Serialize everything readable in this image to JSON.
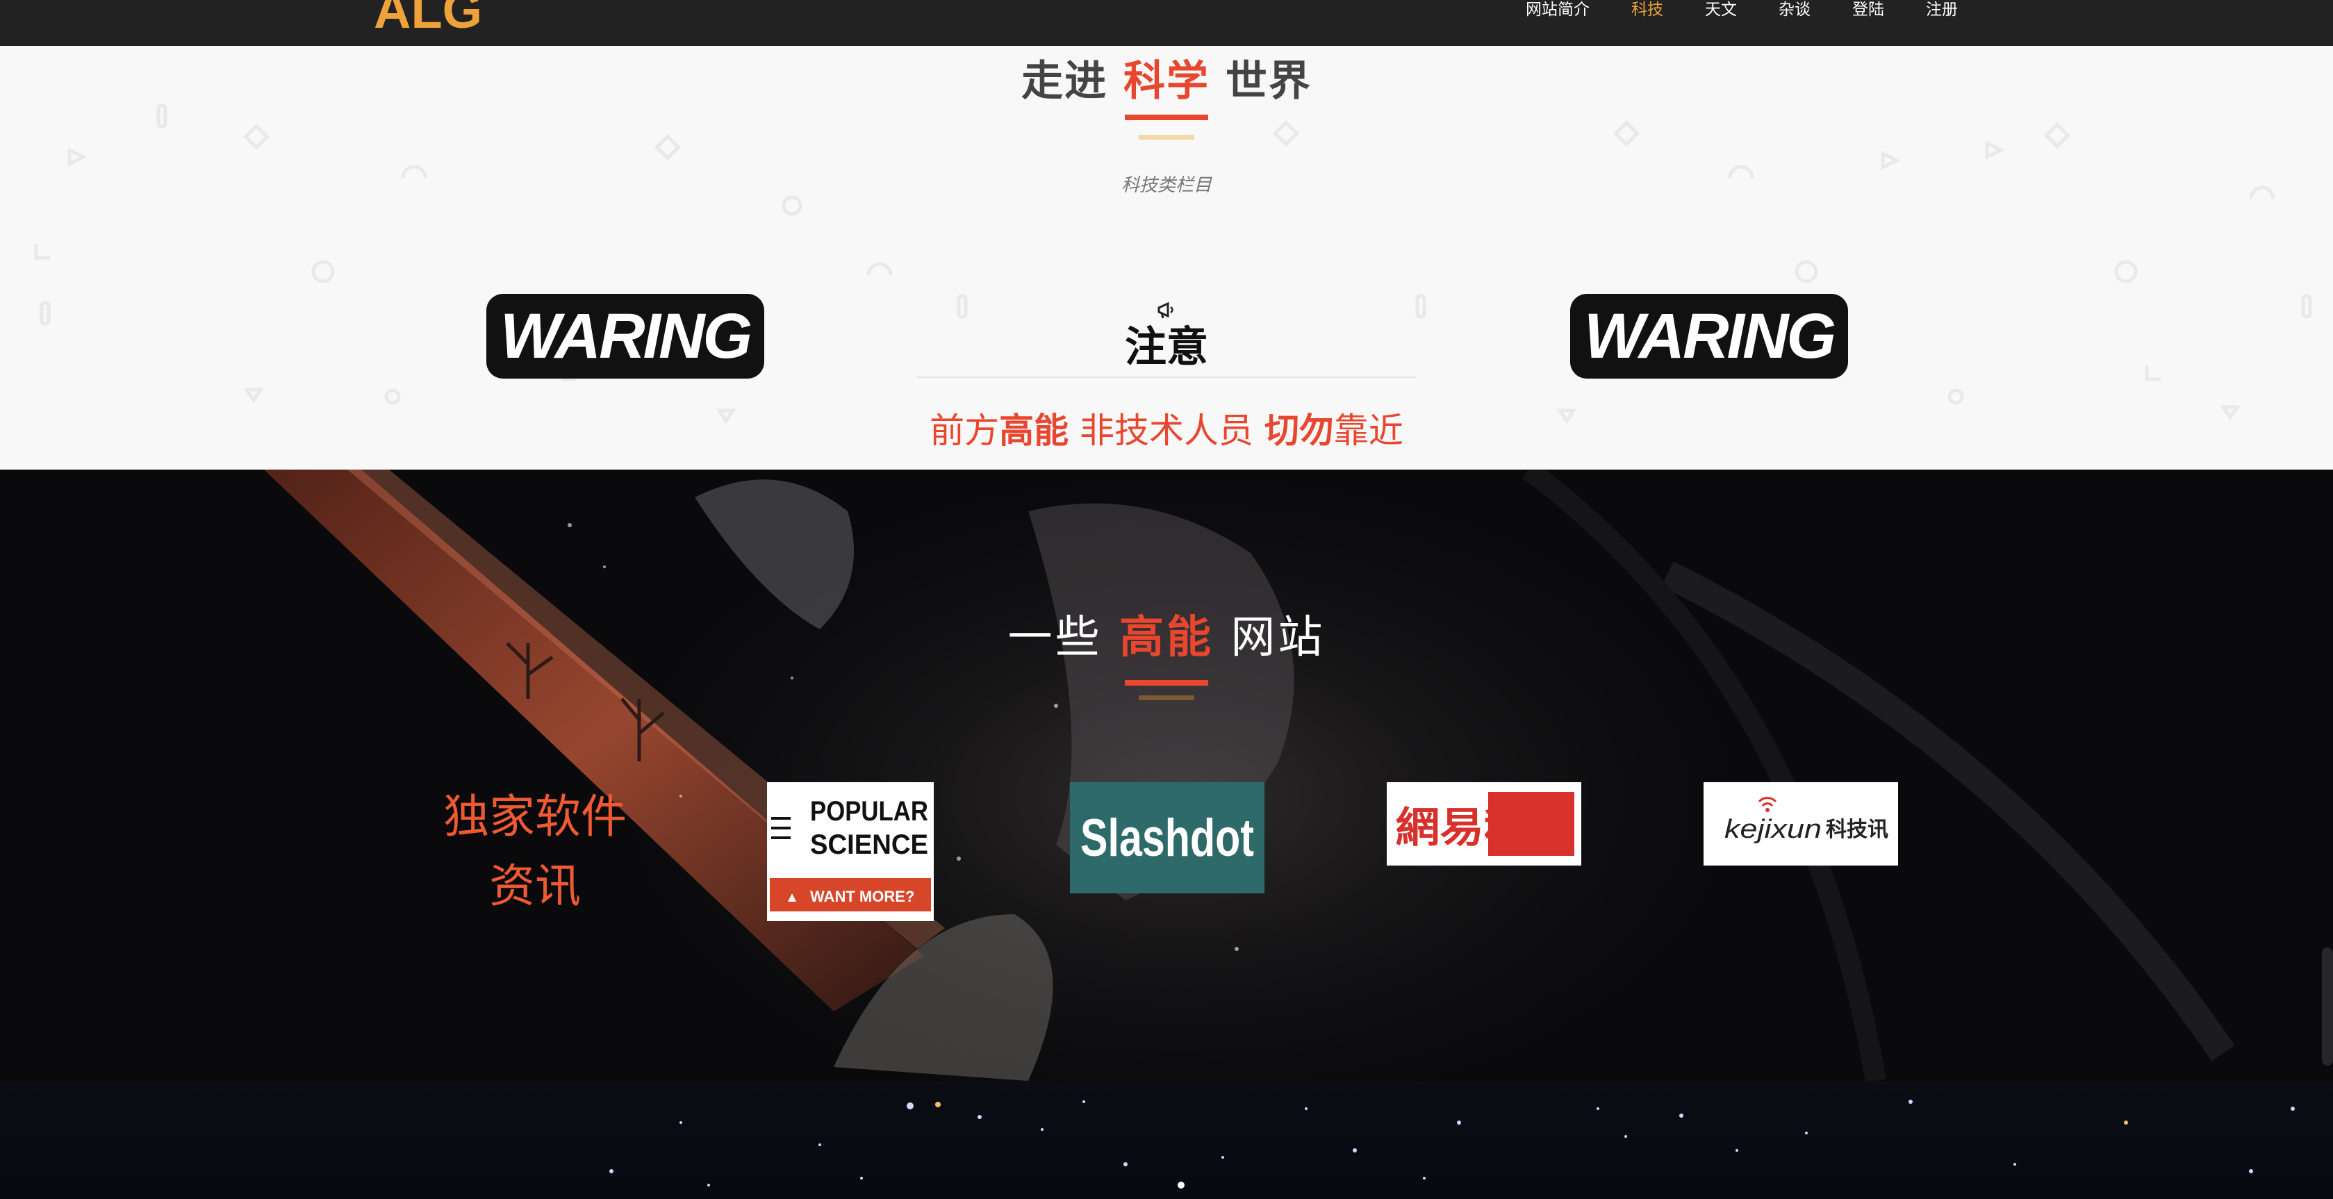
{
  "brand": "ALG",
  "nav": {
    "items": [
      {
        "label": "网站简介",
        "active": false
      },
      {
        "label": "科技",
        "active": true
      },
      {
        "label": "天文",
        "active": false
      },
      {
        "label": "杂谈",
        "active": false
      },
      {
        "label": "登陆",
        "active": false
      },
      {
        "label": "注册",
        "active": false
      }
    ]
  },
  "section_science": {
    "title_pre": "走进",
    "title_highlight": "科学",
    "title_post": "世界",
    "subtitle": "科技类栏目",
    "warning_logo_text": "WARING",
    "notice_title": "注意",
    "notice_body": {
      "part1": "前方",
      "part2_bold": "高能",
      "part3": "非技术人员",
      "part4_bold": "切勿",
      "part5": "靠近"
    }
  },
  "section_sites": {
    "title_pre": "一些",
    "title_highlight": "高能",
    "title_post": "网站",
    "side_label_line1": "独家软件",
    "side_label_line2": "资讯",
    "logos": {
      "popsci": {
        "line1": "POPULAR",
        "line2": "SCIENCE",
        "cta": "WANT MORE?"
      },
      "slashdot": {
        "text": "Slashdot"
      },
      "netease": {
        "text": "網易科技"
      },
      "kejixun": {
        "text_latin": "kejixun",
        "text_cn": "科技讯"
      }
    }
  },
  "colors": {
    "accent_red": "#e8462e",
    "brand_gold": "#f0a23a",
    "nav_bg": "#222222",
    "slashdot_teal": "#2f6a6a"
  }
}
